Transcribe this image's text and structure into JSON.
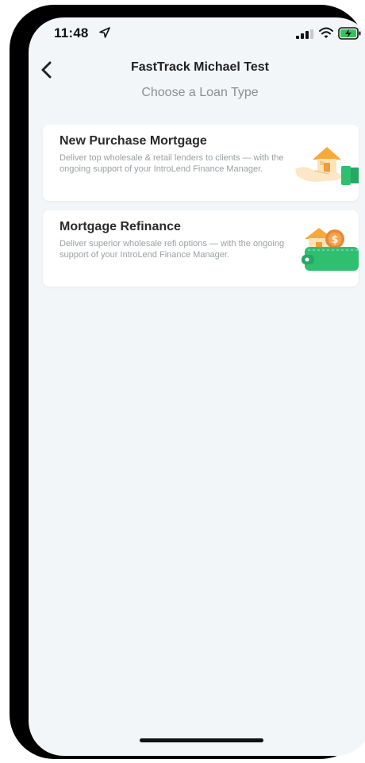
{
  "status_bar": {
    "time": "11:48",
    "location_icon": "location-arrow-icon",
    "signal_icon": "cellular-signal-icon",
    "wifi_icon": "wifi-icon",
    "battery_icon": "battery-charging-icon"
  },
  "nav": {
    "back_icon": "chevron-left-icon",
    "title": "FastTrack Michael Test"
  },
  "page": {
    "subtitle": "Choose a Loan Type"
  },
  "loan_types": [
    {
      "title": "New Purchase Mortgage",
      "description": "Deliver top wholesale & retail lenders to clients — with the ongoing support of your IntroLend Finance Manager.",
      "icon": "house-in-hand-icon"
    },
    {
      "title": "Mortgage Refinance",
      "description": "Deliver superior wholesale refi options — with the ongoing support of your IntroLend Finance Manager.",
      "icon": "house-wallet-coin-icon"
    }
  ],
  "colors": {
    "background": "#f2f6f8",
    "card": "#ffffff",
    "accent_green": "#2fbf71",
    "accent_orange": "#f5a623"
  }
}
